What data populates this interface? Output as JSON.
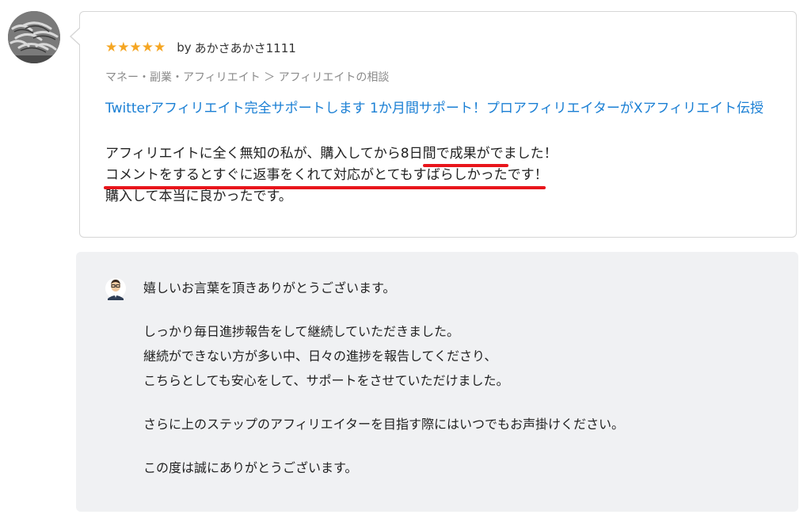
{
  "review": {
    "stars": "★★★★★",
    "by": "by",
    "reviewer": "あかさあかさ1111",
    "category": "マネー・副業・アフィリエイト ＞ アフィリエイトの相談",
    "service_title": "Twitterアフィリエイト完全サポートします 1か月間サポート！プロアフィリエイターがXアフィリエイト伝授",
    "body": [
      "アフィリエイトに全く無知の私が、購入してから8日間で成果がでました！",
      "コメントをするとすぐに返事をくれて対応がとてもすばらしかったです！",
      "購入して本当に良かったです。"
    ],
    "star_color": "#f5a623",
    "link_color": "#1a7fd4",
    "highlight_color": "#e8151b"
  },
  "reply": {
    "lines": [
      "嬉しいお言葉を頂きありがとうございます。",
      "",
      "しっかり毎日進捗報告をして継続していただきました。",
      "継続ができない方が多い中、日々の進捗を報告してくださり、",
      "こちらとしても安心をして、サポートをさせていただけました。",
      "",
      "さらに上のステップのアフィリエイターを目指す際にはいつでもお声掛けください。",
      "",
      "この度は誠にありがとうございます。"
    ],
    "background": "#f0f1f3"
  }
}
